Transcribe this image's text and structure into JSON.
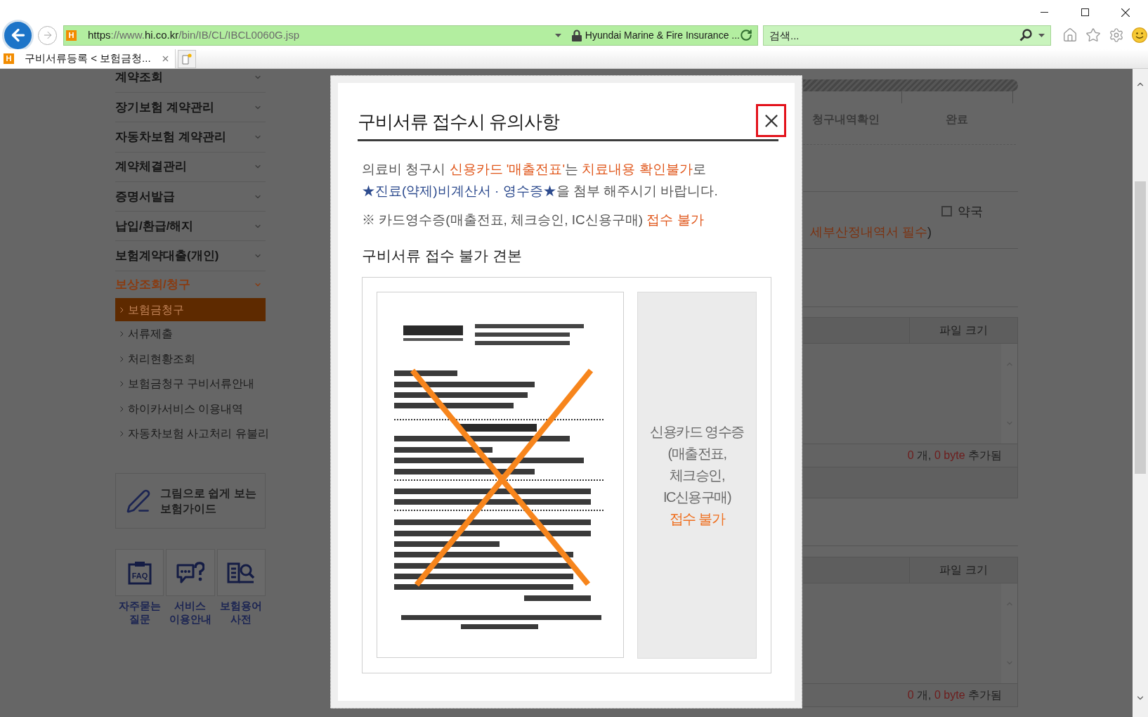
{
  "browser": {
    "address_bar": {
      "favicon": "H",
      "url": [
        {
          "text": "https",
          "strong": true
        },
        {
          "text": "://www.",
          "strong": false
        },
        {
          "text": "hi.co.kr",
          "strong": true
        },
        {
          "text": "/bin/IB/CL/IBCL0060G.jsp",
          "strong": false
        }
      ],
      "secure": true,
      "site_identity": "Hyundai Marine & Fire Insurance ..."
    },
    "search": {
      "placeholder": "검색..."
    },
    "tabs": [
      {
        "favicon": "H",
        "label": "구비서류등록 < 보험금청...",
        "selected": true
      }
    ]
  },
  "sidebar": {
    "menu": [
      {
        "label": "계약조회",
        "selected": false
      },
      {
        "label": "장기보험 계약관리",
        "selected": false
      },
      {
        "label": "자동차보험 계약관리",
        "selected": false
      },
      {
        "label": "계약체결관리",
        "selected": false
      },
      {
        "label": "증명서발급",
        "selected": false
      },
      {
        "label": "납입/환급/해지",
        "selected": false
      },
      {
        "label": "보험계약대출(개인)",
        "selected": false
      },
      {
        "label": "보상조회/청구",
        "selected": true,
        "children": [
          {
            "label": "보험금청구",
            "selected": true
          },
          {
            "label": "서류제출",
            "selected": false
          },
          {
            "label": "처리현황조회",
            "selected": false
          },
          {
            "label": "보험금청구 구비서류안내",
            "selected": false
          },
          {
            "label": "하이카서비스 이용내역",
            "selected": false
          },
          {
            "label": "자동차보험 사고처리 유불리",
            "selected": false
          }
        ]
      }
    ],
    "guide_banner": {
      "lines": [
        "그림으로 쉽게 보는",
        "보험가이드"
      ]
    },
    "quick_links": [
      {
        "label_lines": [
          "자주묻는",
          "질문"
        ],
        "icon_text": "FAQ"
      },
      {
        "label_lines": [
          "서비스",
          "이용안내"
        ]
      },
      {
        "label_lines": [
          "보험용어",
          "사전"
        ]
      }
    ]
  },
  "claim_page": {
    "progress": {
      "level": 1
    },
    "steps": [
      {
        "label": "청구내역확인"
      },
      {
        "label": "완료"
      }
    ],
    "pharmacy_option": {
      "label": "약국",
      "checked": false
    },
    "requirement_note": [
      {
        "text": "세부산정내역서 필수",
        "kind": "warning"
      },
      {
        "text": ")",
        "kind": "plain"
      }
    ],
    "file_lists": [
      {
        "size_header": "파일 크기",
        "summary": [
          {
            "text": "0",
            "kind": "count"
          },
          {
            "text": " 개, ",
            "kind": "plain"
          },
          {
            "text": "0 byte",
            "kind": "count"
          },
          {
            "text": " 추가됨",
            "kind": "plain"
          }
        ]
      },
      {
        "size_header": "파일 크기",
        "summary": [
          {
            "text": "0",
            "kind": "count"
          },
          {
            "text": " 개, ",
            "kind": "plain"
          },
          {
            "text": "0 byte",
            "kind": "count"
          },
          {
            "text": " 추가됨",
            "kind": "plain"
          }
        ]
      }
    ]
  },
  "modal": {
    "title": "구비서류 접수시 유의사항",
    "close_button": {
      "highlighted": true
    },
    "intro_lines": [
      [
        {
          "text": "의료비 청구시 ",
          "kind": "plain"
        },
        {
          "text": "신용카드 '매출전표'",
          "kind": "warning"
        },
        {
          "text": "는 ",
          "kind": "plain"
        },
        {
          "text": "치료내용 확인불가",
          "kind": "warning"
        },
        {
          "text": "로",
          "kind": "plain"
        }
      ],
      [
        {
          "text": "★진료(약제)비계산서 · 영수증★",
          "kind": "highlight"
        },
        {
          "text": "을 첨부 해주시기 바랍니다.",
          "kind": "plain"
        }
      ]
    ],
    "note": [
      {
        "text": "※ 카드영수증(매출전표, 체크승인, IC신용구매) ",
        "kind": "plain"
      },
      {
        "text": "접수 불가",
        "kind": "warning"
      }
    ],
    "sample_heading": "구비서류 접수 불가 견본",
    "sample_caption": [
      {
        "text": "신용카드 영수증",
        "kind": "plain"
      },
      {
        "text": "(매출전표,",
        "kind": "plain"
      },
      {
        "text": "체크승인,",
        "kind": "plain"
      },
      {
        "text": "IC신용구매)",
        "kind": "plain"
      },
      {
        "text": "접수 불가",
        "kind": "warning"
      }
    ]
  }
}
